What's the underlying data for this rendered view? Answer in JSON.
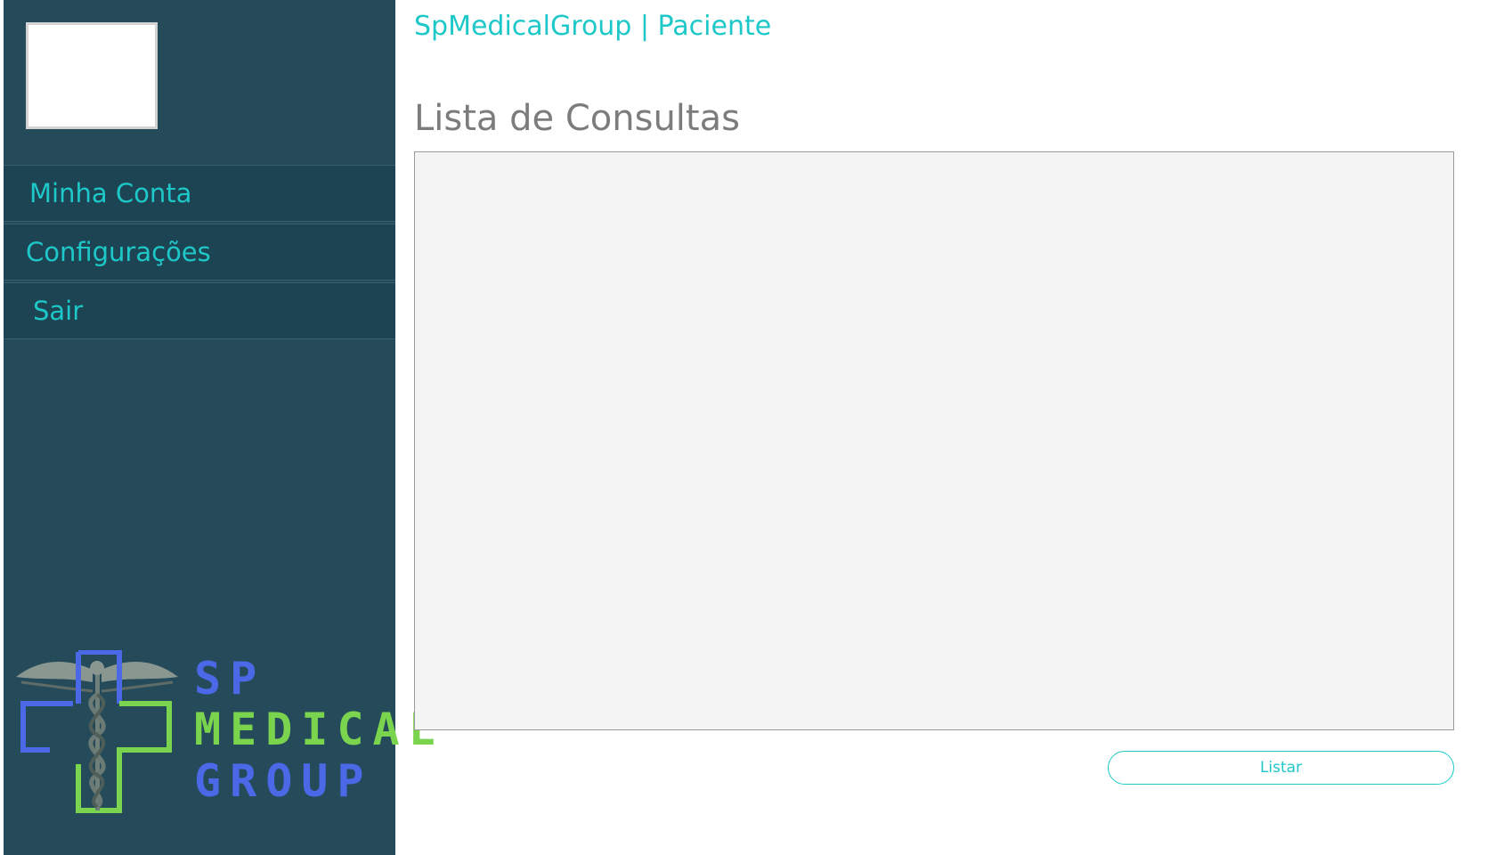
{
  "header": {
    "title": "SpMedicalGroup | Paciente"
  },
  "sidebar": {
    "items": [
      {
        "label": "Minha Conta"
      },
      {
        "label": "Configurações"
      },
      {
        "label": "Sair"
      }
    ],
    "logo": {
      "line1": "SP",
      "line2": "MEDICAL",
      "line3": "GROUP"
    }
  },
  "main": {
    "section_title": "Lista de Consultas",
    "list_button_label": "Listar"
  },
  "colors": {
    "sidebar_bg": "#254b5b",
    "nav_item_bg": "#1c4453",
    "accent": "#1ec8c8",
    "logo_blue": "#4b68e6",
    "logo_green": "#7ad44d",
    "section_title": "#7c7c7c",
    "list_bg": "#f4f4f4"
  },
  "icons": {
    "logo_emblem": "caduceus-cross-icon"
  }
}
